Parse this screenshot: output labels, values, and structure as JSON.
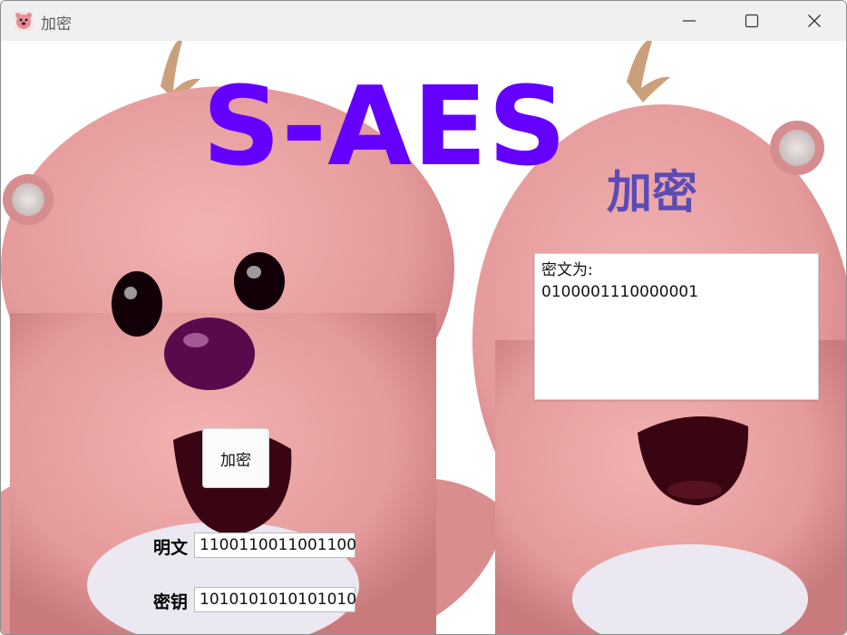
{
  "window": {
    "title": "加密",
    "minimize_glyph": "—",
    "maximize_glyph": "☐",
    "close_glyph": "✕"
  },
  "header": {
    "main_title": "S-AES",
    "subtitle": "加密"
  },
  "output": {
    "label": "密文为:",
    "value": "0100001110000001"
  },
  "actions": {
    "encrypt_label": "加密"
  },
  "form": {
    "plaintext_label": "明文",
    "plaintext_value": "1100110011001100",
    "key_label": "密钥",
    "key_value": "1010101010101010"
  },
  "colors": {
    "title_color": "#6300ff",
    "subtitle_color": "#5b4bb5",
    "character_pink": "#e9a2a2"
  },
  "icons": {
    "app_icon": "beaver-icon",
    "minimize": "minimize-icon",
    "maximize": "maximize-icon",
    "close": "close-icon"
  }
}
